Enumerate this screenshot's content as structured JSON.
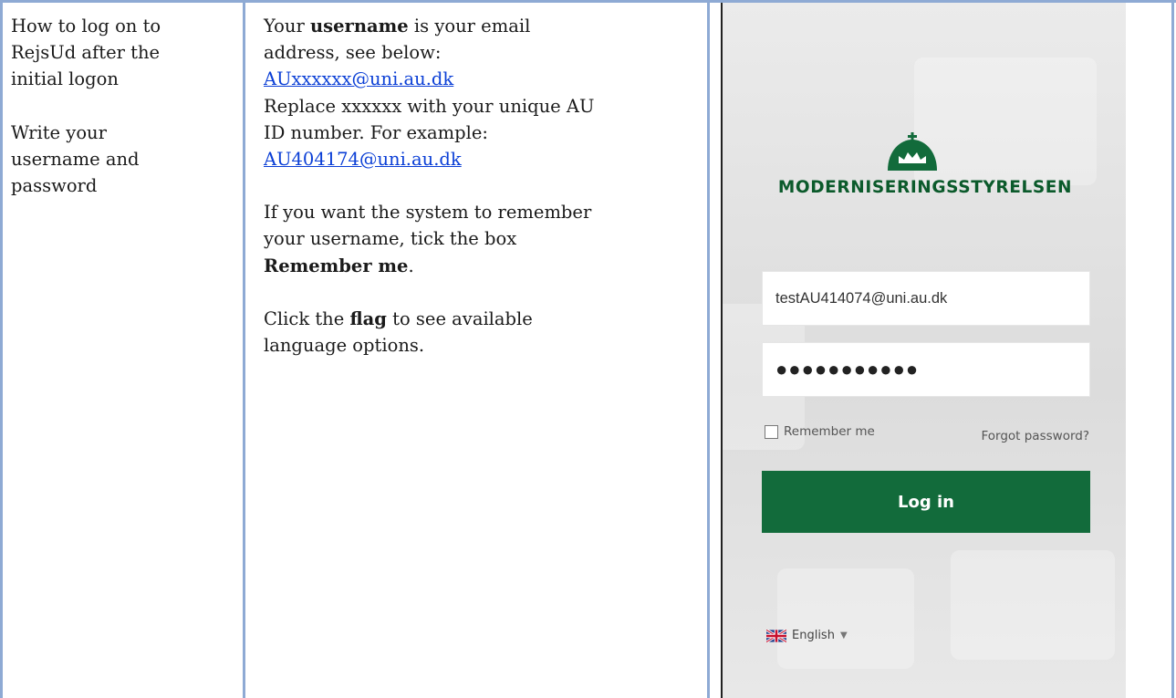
{
  "col1": {
    "line1": "How to log on to",
    "line2": "RejsUd after the",
    "line3": "initial logon",
    "line4": "Write your",
    "line5": "username and",
    "line6": "password"
  },
  "col2": {
    "p1_pre": "Your ",
    "p1_bold": "username",
    "p1_post": " is your email",
    "p1_line2": "address, see below:",
    "email_template": "AUxxxxxx@uni.au.dk",
    "replace_line1": "Replace xxxxxx with your unique AU",
    "replace_line2": "ID number. For example:",
    "email_example": "AU404174@uni.au.dk",
    "remember_line1": "If you want the system to remember",
    "remember_line2": "your username, tick the box",
    "remember_bold": "Remember me",
    "remember_end": ".",
    "flag_pre": "Click the ",
    "flag_bold": "flag",
    "flag_post": " to see available",
    "flag_line2": "language options."
  },
  "login": {
    "brand": "MODERNISERINGSSTYRELSEN",
    "username_value": "testAU414074@uni.au.dk",
    "password_mask": "●●●●●●●●●●●",
    "remember_label": "Remember me",
    "forgot_label": "Forgot password?",
    "login_label": "Log in",
    "language_label": "English"
  },
  "colors": {
    "brand_green": "#126b3b",
    "link_blue": "#0b3fd6",
    "table_border": "#8eaad4"
  },
  "icons": {
    "crown": "crown-logo-icon",
    "flag": "uk-flag-icon",
    "caret": "caret-down-icon"
  }
}
